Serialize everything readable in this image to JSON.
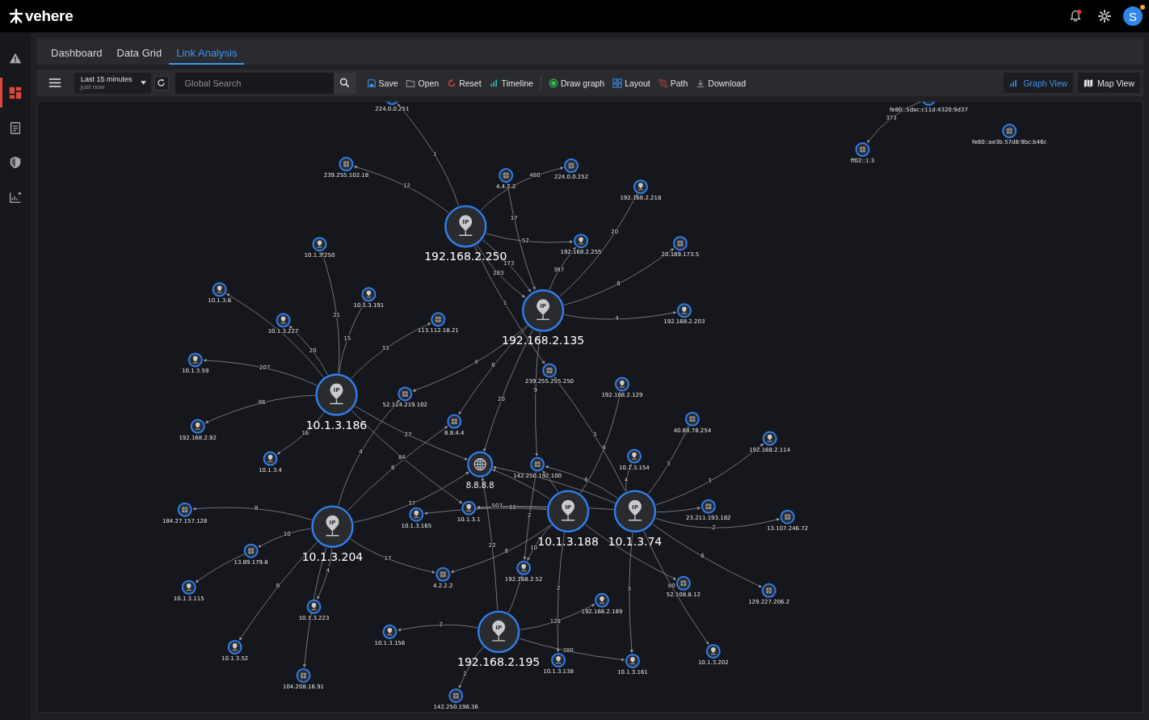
{
  "header": {
    "logo": "vehere",
    "bell": {
      "unread": true
    },
    "avatar": {
      "initial": "S",
      "alert": true
    }
  },
  "sidebar": {
    "items": [
      {
        "kind": "alerts",
        "selected": false
      },
      {
        "kind": "dashboard",
        "selected": true
      },
      {
        "kind": "reports",
        "selected": false
      },
      {
        "kind": "security",
        "selected": false
      },
      {
        "kind": "analytics",
        "selected": false
      }
    ]
  },
  "tabs": [
    {
      "label": "Dashboard",
      "selected": false
    },
    {
      "label": "Data Grid",
      "selected": false
    },
    {
      "label": "Link Analysis",
      "selected": true
    }
  ],
  "toolbar": {
    "time_range": {
      "label": "Last 15 minutes",
      "sublabel": "just now"
    },
    "search": {
      "placeholder": "Global Search"
    },
    "actions": [
      {
        "kind": "save",
        "label": "Save"
      },
      {
        "kind": "open",
        "label": "Open"
      },
      {
        "kind": "reset",
        "label": "Reset"
      },
      {
        "kind": "timeline",
        "label": "Timeline"
      },
      {
        "kind": "draw",
        "label": "Draw graph"
      },
      {
        "kind": "layout",
        "label": "Layout"
      },
      {
        "kind": "path",
        "label": "Path"
      },
      {
        "kind": "download",
        "label": "Download"
      }
    ],
    "views": [
      {
        "kind": "graph",
        "label": "Graph View",
        "selected": true
      },
      {
        "kind": "map",
        "label": "Map View",
        "selected": false
      }
    ]
  },
  "graph": {
    "nodes": [
      {
        "kind": "hub",
        "label": "192.168.2.250",
        "badge": "IP"
      },
      {
        "kind": "hub",
        "label": "192.168.2.135",
        "badge": "IP"
      },
      {
        "kind": "hub",
        "label": "10.1.3.186",
        "badge": "IP"
      },
      {
        "kind": "hub",
        "label": "10.1.3.204",
        "badge": "IP"
      },
      {
        "kind": "hub",
        "label": "10.1.3.188",
        "badge": "IP"
      },
      {
        "kind": "hub",
        "label": "10.1.3.74",
        "badge": "IP"
      },
      {
        "kind": "globe",
        "label": "8.8.8.8"
      },
      {
        "kind": "hub",
        "label": "192.168.2.195",
        "badge": "IP"
      },
      {
        "kind": "server",
        "label": "224.0.0.251"
      },
      {
        "kind": "server",
        "label": "fe80::5dac:c11d:4320:9d37"
      },
      {
        "kind": "server",
        "label": "239.255.102.18"
      },
      {
        "kind": "server",
        "label": "4.4.2.2"
      },
      {
        "kind": "server",
        "label": "224.0.0.252"
      },
      {
        "kind": "ip",
        "label": "192.168.2.218"
      },
      {
        "kind": "server",
        "label": "fe80::ae3b:57d8:9bc:b46c"
      },
      {
        "kind": "server",
        "label": "ff02::1:3"
      },
      {
        "kind": "ip",
        "label": "10.1.3.250"
      },
      {
        "kind": "ip",
        "label": "192.168.2.255"
      },
      {
        "kind": "server",
        "label": "20.189.173.5"
      },
      {
        "kind": "ip",
        "label": "10.1.3.6"
      },
      {
        "kind": "ip",
        "label": "10.1.3.191"
      },
      {
        "kind": "ip",
        "label": "10.1.3.227"
      },
      {
        "kind": "server",
        "label": "113.112.18.21"
      },
      {
        "kind": "ip",
        "label": "192.168.2.203"
      },
      {
        "kind": "ip",
        "label": "10.1.3.59"
      },
      {
        "kind": "server",
        "label": "239.255.255.250"
      },
      {
        "kind": "ip",
        "label": "192.168.2.129"
      },
      {
        "kind": "server",
        "label": "52.114.219.102"
      },
      {
        "kind": "ip",
        "label": "192.168.2.92"
      },
      {
        "kind": "server",
        "label": "8.8.4.4"
      },
      {
        "kind": "server",
        "label": "40.88.78.254"
      },
      {
        "kind": "ip",
        "label": "192.168.2.114"
      },
      {
        "kind": "ip",
        "label": "10.1.3.4"
      },
      {
        "kind": "ip",
        "label": "10.1.3.154"
      },
      {
        "kind": "server",
        "label": "142.250.192.100"
      },
      {
        "kind": "server",
        "label": "184.27.157.128"
      },
      {
        "kind": "ip",
        "label": "10.1.3.1"
      },
      {
        "kind": "ip",
        "label": "10.1.3.165"
      },
      {
        "kind": "server",
        "label": "23.211.193.182"
      },
      {
        "kind": "server",
        "label": "13.107.246.72"
      },
      {
        "kind": "server",
        "label": "13.89.179.8"
      },
      {
        "kind": "server",
        "label": "4.2.2.2"
      },
      {
        "kind": "ip",
        "label": "192.168.2.52"
      },
      {
        "kind": "server",
        "label": "52.108.8.12"
      },
      {
        "kind": "ip",
        "label": "10.1.3.115"
      },
      {
        "kind": "server",
        "label": "129.227.206.2"
      },
      {
        "kind": "ip",
        "label": "192.168.2.189"
      },
      {
        "kind": "ip",
        "label": "10.1.3.223"
      },
      {
        "kind": "ip",
        "label": "10.1.3.156"
      },
      {
        "kind": "ip",
        "label": "10.1.3.52"
      },
      {
        "kind": "ip",
        "label": "10.1.3.202"
      },
      {
        "kind": "ip",
        "label": "10.1.3.138"
      },
      {
        "kind": "ip",
        "label": "10.1.3.161"
      },
      {
        "kind": "server",
        "label": "104.208.16.91"
      },
      {
        "kind": "server",
        "label": "142.250.196.36"
      }
    ],
    "edges": [
      {
        "label": "12"
      },
      {
        "label": "1"
      },
      {
        "label": "480"
      },
      {
        "label": "52"
      },
      {
        "label": "17"
      },
      {
        "label": "387"
      },
      {
        "label": "283"
      },
      {
        "label": "173"
      },
      {
        "label": "1"
      },
      {
        "label": "20"
      },
      {
        "label": "8"
      },
      {
        "label": "4"
      },
      {
        "label": "4"
      },
      {
        "label": "8"
      },
      {
        "label": "20"
      },
      {
        "label": "9"
      },
      {
        "label": "21"
      },
      {
        "label": "20"
      },
      {
        "label": "15"
      },
      {
        "label": "33"
      },
      {
        "label": "207"
      },
      {
        "label": "86"
      },
      {
        "label": "16"
      },
      {
        "label": "27"
      },
      {
        "label": "84"
      },
      {
        "label": "4"
      },
      {
        "label": "8"
      },
      {
        "label": "37"
      },
      {
        "label": "8"
      },
      {
        "label": "10"
      },
      {
        "label": "8"
      },
      {
        "label": "4"
      },
      {
        "label": "17"
      },
      {
        "label": "507"
      },
      {
        "label": "68"
      },
      {
        "label": "8"
      },
      {
        "label": "8"
      },
      {
        "label": "6"
      },
      {
        "label": "10"
      },
      {
        "label": "2"
      },
      {
        "label": "2"
      },
      {
        "label": "3"
      },
      {
        "label": "3"
      },
      {
        "label": "4"
      },
      {
        "label": "3"
      },
      {
        "label": "2"
      },
      {
        "label": "6"
      },
      {
        "label": "3"
      },
      {
        "label": "80"
      },
      {
        "label": "2"
      },
      {
        "label": "128"
      },
      {
        "label": "380"
      },
      {
        "label": "22"
      },
      {
        "label": "2"
      },
      {
        "label": "373"
      }
    ]
  }
}
